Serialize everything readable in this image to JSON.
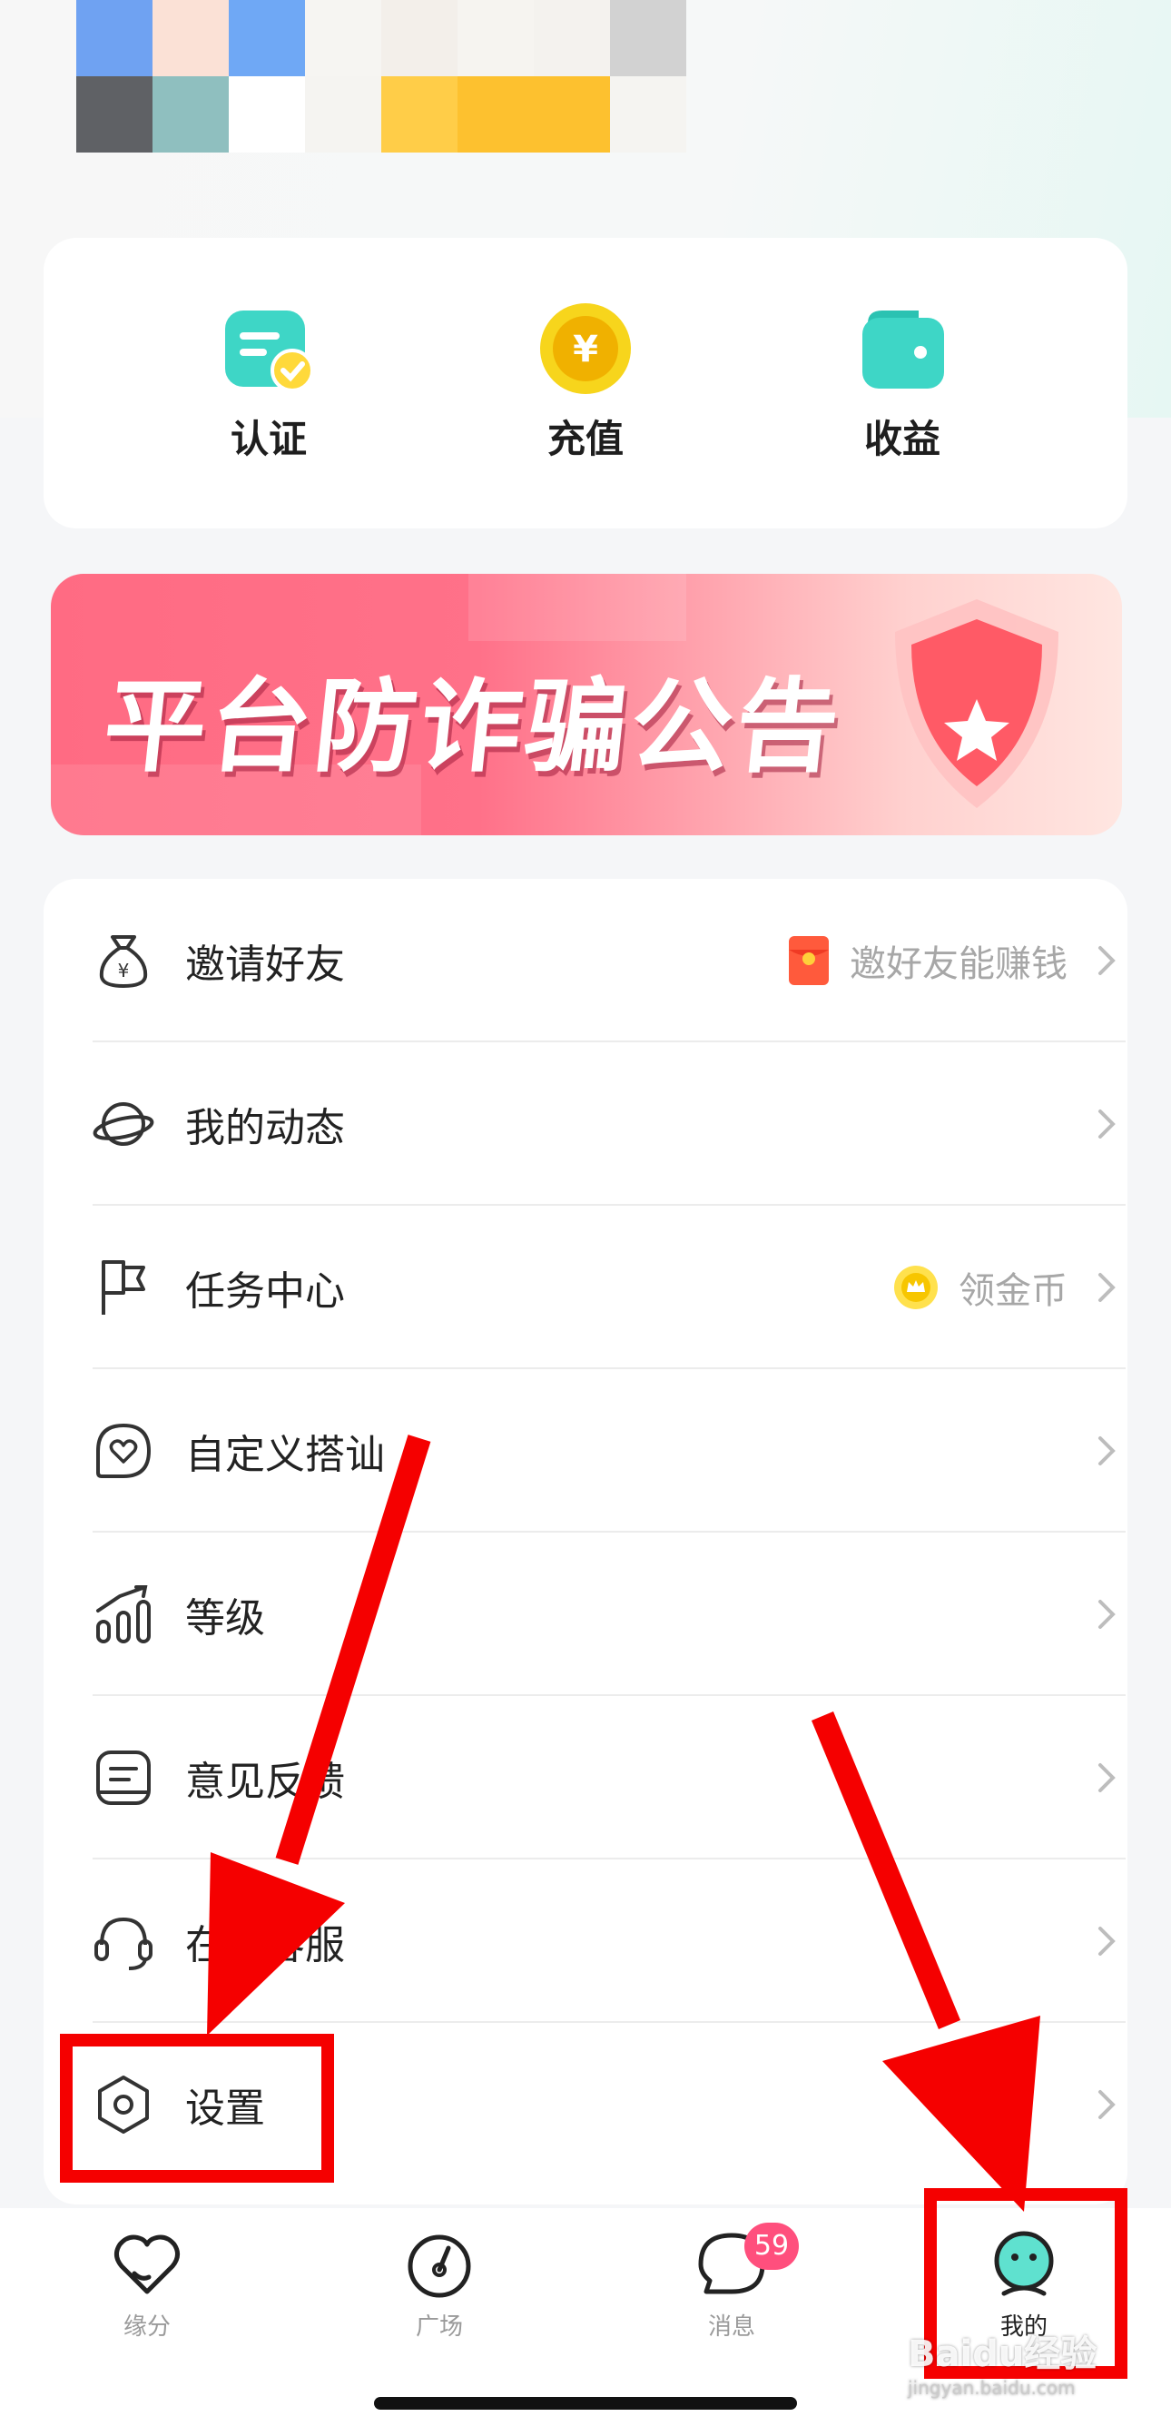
{
  "quick_actions": [
    {
      "label": "认证",
      "icon": "certification-icon"
    },
    {
      "label": "充值",
      "icon": "recharge-coin-icon"
    },
    {
      "label": "收益",
      "icon": "wallet-icon"
    }
  ],
  "banner": {
    "title": "平台防诈骗公告",
    "icon": "shield-star-icon"
  },
  "menu": [
    {
      "label": "邀请好友",
      "hint": "邀好友能赚钱",
      "icon": "money-bag-icon",
      "hint_icon": "red-envelope-icon"
    },
    {
      "label": "我的动态",
      "hint": "",
      "icon": "planet-icon"
    },
    {
      "label": "任务中心",
      "hint": "领金币",
      "icon": "flag-icon",
      "hint_icon": "gold-coin-icon"
    },
    {
      "label": "自定义搭讪",
      "hint": "",
      "icon": "heart-bubble-icon"
    },
    {
      "label": "等级",
      "hint": "",
      "icon": "level-chart-icon"
    },
    {
      "label": "意见反馈",
      "hint": "",
      "icon": "feedback-icon"
    },
    {
      "label": "在线客服",
      "hint": "",
      "icon": "headset-icon"
    },
    {
      "label": "设置",
      "hint": "",
      "icon": "settings-icon"
    }
  ],
  "tabs": [
    {
      "label": "缘分",
      "icon": "heart-icon",
      "active": false
    },
    {
      "label": "广场",
      "icon": "compass-icon",
      "active": false
    },
    {
      "label": "消息",
      "icon": "chat-bubble-icon",
      "active": false,
      "badge": "59"
    },
    {
      "label": "我的",
      "icon": "smiley-face-icon",
      "active": true
    }
  ],
  "watermark": {
    "text": "Baidu经验",
    "sub": "jingyan.baidu.com"
  },
  "colors": {
    "accent": "#3ed6c6",
    "banner": "#ff6b83",
    "badge": "#ff4f7d",
    "annotation": "#f50000"
  }
}
